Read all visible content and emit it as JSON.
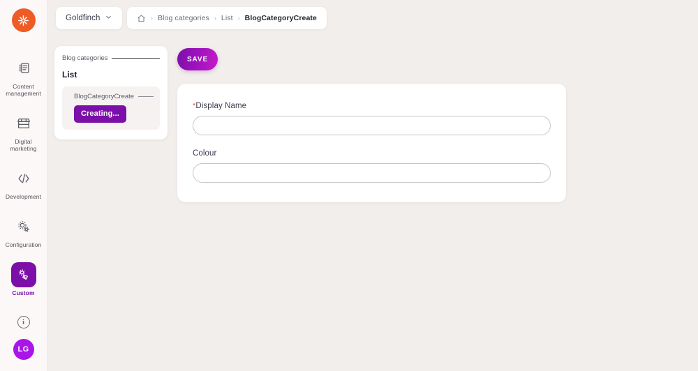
{
  "app": {
    "logo_icon": "asterisk-starburst-logo",
    "background_color": "#f2eeeb",
    "accent_color": "#7b0fa8",
    "logo_color": "#ef5b25"
  },
  "topbar": {
    "tenant": {
      "name": "Goldfinch",
      "chevron_icon": "chevron-down-icon"
    },
    "breadcrumb": {
      "home_icon": "home-icon",
      "separator": "›",
      "items": [
        {
          "label": "Blog categories",
          "current": false
        },
        {
          "label": "List",
          "current": false
        },
        {
          "label": "BlogCategoryCreate",
          "current": true
        }
      ]
    }
  },
  "sidebar": {
    "items": [
      {
        "label": "Content management",
        "icon": "documents-icon",
        "active": false
      },
      {
        "label": "Digital marketing",
        "icon": "storefront-icon",
        "active": false
      },
      {
        "label": "Development",
        "icon": "code-brackets-icon",
        "active": false
      },
      {
        "label": "Configuration",
        "icon": "gears-icon",
        "active": false
      },
      {
        "label": "Custom",
        "icon": "puzzle-gear-icon",
        "active": true
      }
    ],
    "bottom": {
      "info_icon": "info-circle-icon",
      "info_glyph": "i",
      "avatar_initials": "LG",
      "avatar_color": "#a915e8"
    }
  },
  "nav_card": {
    "root_label": "Blog categories",
    "heading": "List",
    "sub_label": "BlogCategoryCreate",
    "status_button": "Creating..."
  },
  "main": {
    "save_label": "SAVE",
    "fields": [
      {
        "label": "Display Name",
        "required": true,
        "required_marker": "*",
        "value": "",
        "placeholder": ""
      },
      {
        "label": "Colour",
        "required": false,
        "required_marker": "",
        "value": "",
        "placeholder": ""
      }
    ]
  }
}
